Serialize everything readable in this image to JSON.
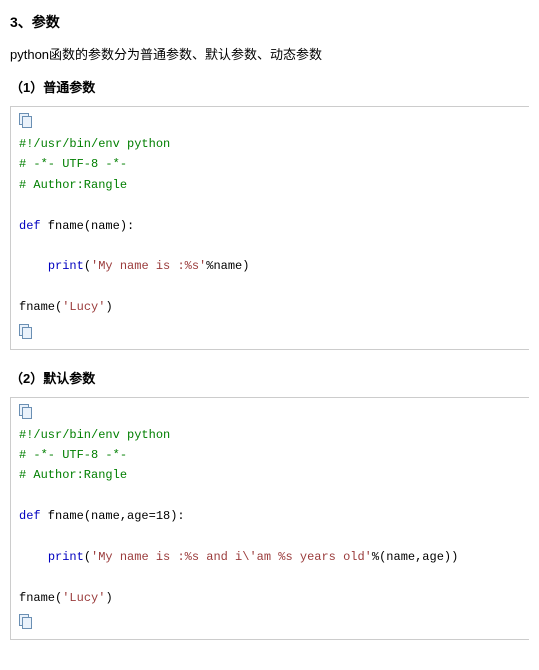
{
  "heading": "3、参数",
  "intro": "python函数的参数分为普通参数、默认参数、动态参数",
  "sections": [
    {
      "title": "（1）普通参数",
      "code": {
        "c1": "#!/usr/bin/env python",
        "c2": "# -*- UTF-8 -*-",
        "c3": "# Author:Rangle",
        "kw_def": "def",
        "def_rest": " fname(name):",
        "kw_print": "print",
        "print_open": "(",
        "str1": "'My name is :%s'",
        "print_rest": "%name)",
        "call_fn": "fname(",
        "call_str": "'Lucy'",
        "call_close": ")"
      }
    },
    {
      "title": "（2）默认参数",
      "code": {
        "c1": "#!/usr/bin/env python",
        "c2": "# -*- UTF-8 -*-",
        "c3": "# Author:Rangle",
        "kw_def": "def",
        "def_rest": " fname(name,age=18):",
        "kw_print": "print",
        "print_open": "(",
        "str1": "'My name is :%s and i\\'am %s years old'",
        "print_rest": "%(name,age))",
        "call_fn": "fname(",
        "call_str": "'Lucy'",
        "call_close": ")"
      }
    }
  ]
}
